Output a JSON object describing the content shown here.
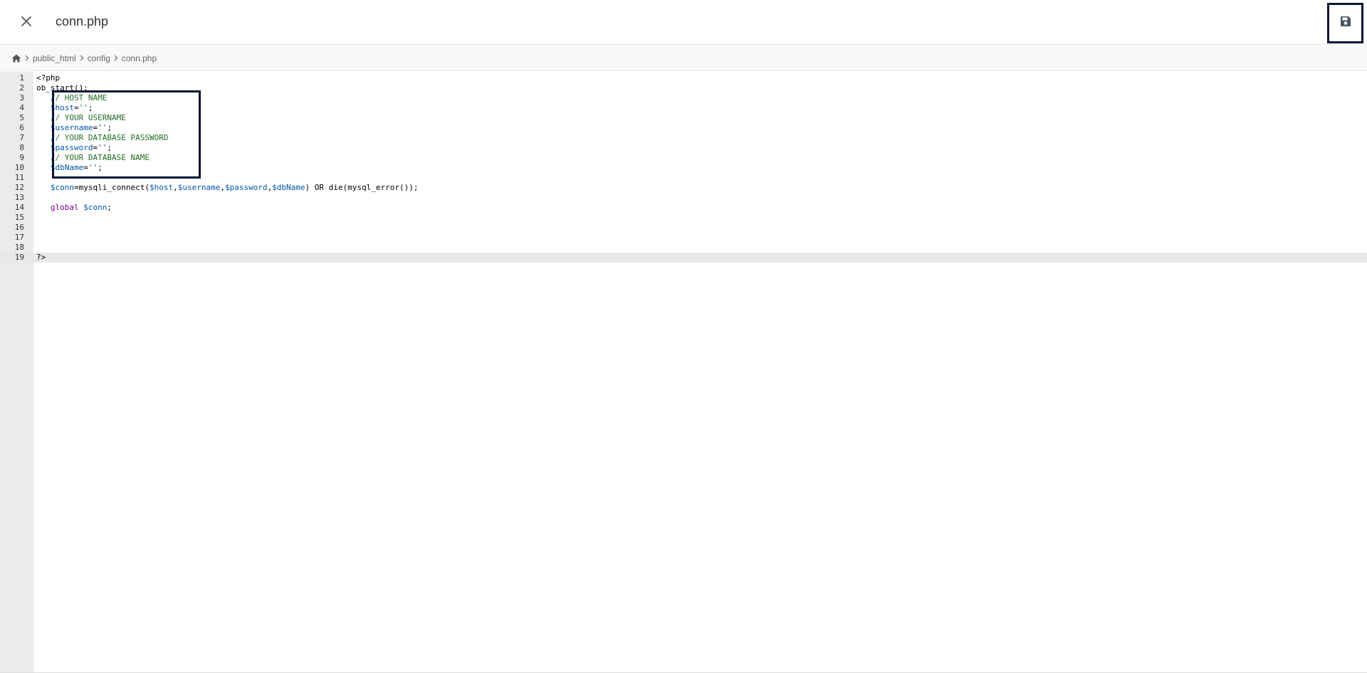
{
  "header": {
    "title": "conn.php",
    "close_icon": "close-icon",
    "save_icon": "save-icon"
  },
  "breadcrumb": {
    "home_icon": "home-icon",
    "items": [
      "public_html",
      "config",
      "conn.php"
    ]
  },
  "editor": {
    "active_line": 19,
    "lines": [
      {
        "n": "1",
        "tokens": [
          {
            "t": "<?php",
            "k": "plain"
          }
        ]
      },
      {
        "n": "2",
        "tokens": [
          {
            "t": "ob_start();",
            "k": "plain"
          }
        ]
      },
      {
        "n": "3",
        "tokens": [
          {
            "t": "   ",
            "k": "plain"
          },
          {
            "t": "// HOST NAME",
            "k": "comment"
          }
        ]
      },
      {
        "n": "4",
        "tokens": [
          {
            "t": "   ",
            "k": "plain"
          },
          {
            "t": "$host",
            "k": "var"
          },
          {
            "t": "=",
            "k": "plain"
          },
          {
            "t": "''",
            "k": "comment"
          },
          {
            "t": ";",
            "k": "plain"
          }
        ]
      },
      {
        "n": "5",
        "tokens": [
          {
            "t": "   ",
            "k": "plain"
          },
          {
            "t": "// YOUR USERNAME",
            "k": "comment"
          }
        ]
      },
      {
        "n": "6",
        "tokens": [
          {
            "t": "   ",
            "k": "plain"
          },
          {
            "t": "$username",
            "k": "var"
          },
          {
            "t": "=",
            "k": "plain"
          },
          {
            "t": "''",
            "k": "comment"
          },
          {
            "t": ";",
            "k": "plain"
          }
        ]
      },
      {
        "n": "7",
        "tokens": [
          {
            "t": "   ",
            "k": "plain"
          },
          {
            "t": "// YOUR DATABASE PASSWORD",
            "k": "comment"
          }
        ]
      },
      {
        "n": "8",
        "tokens": [
          {
            "t": "   ",
            "k": "plain"
          },
          {
            "t": "$password",
            "k": "var"
          },
          {
            "t": "=",
            "k": "plain"
          },
          {
            "t": "''",
            "k": "comment"
          },
          {
            "t": ";",
            "k": "plain"
          }
        ]
      },
      {
        "n": "9",
        "tokens": [
          {
            "t": "   ",
            "k": "plain"
          },
          {
            "t": "// YOUR DATABASE NAME",
            "k": "comment"
          }
        ]
      },
      {
        "n": "10",
        "tokens": [
          {
            "t": "   ",
            "k": "plain"
          },
          {
            "t": "$dbName",
            "k": "var"
          },
          {
            "t": "=",
            "k": "plain"
          },
          {
            "t": "''",
            "k": "comment"
          },
          {
            "t": ";",
            "k": "plain"
          }
        ]
      },
      {
        "n": "11",
        "tokens": []
      },
      {
        "n": "12",
        "tokens": [
          {
            "t": "   ",
            "k": "plain"
          },
          {
            "t": "$conn",
            "k": "var"
          },
          {
            "t": "=mysqli_connect(",
            "k": "plain"
          },
          {
            "t": "$host",
            "k": "var"
          },
          {
            "t": ",",
            "k": "plain"
          },
          {
            "t": "$username",
            "k": "var"
          },
          {
            "t": ",",
            "k": "plain"
          },
          {
            "t": "$password",
            "k": "var"
          },
          {
            "t": ",",
            "k": "plain"
          },
          {
            "t": "$dbName",
            "k": "var"
          },
          {
            "t": ") OR die(mysql_error());",
            "k": "plain"
          }
        ]
      },
      {
        "n": "13",
        "tokens": []
      },
      {
        "n": "14",
        "tokens": [
          {
            "t": "   ",
            "k": "plain"
          },
          {
            "t": "global",
            "k": "keyword"
          },
          {
            "t": " ",
            "k": "plain"
          },
          {
            "t": "$conn",
            "k": "var"
          },
          {
            "t": ";",
            "k": "plain"
          }
        ]
      },
      {
        "n": "15",
        "tokens": []
      },
      {
        "n": "16",
        "tokens": []
      },
      {
        "n": "17",
        "tokens": []
      },
      {
        "n": "18",
        "tokens": []
      },
      {
        "n": "19",
        "tokens": [
          {
            "t": "?>",
            "k": "plain"
          }
        ]
      }
    ]
  },
  "colors": {
    "comment": "#236e24",
    "variable": "#0055aa",
    "keyword": "#770088",
    "highlight_border": "#0b1533"
  }
}
